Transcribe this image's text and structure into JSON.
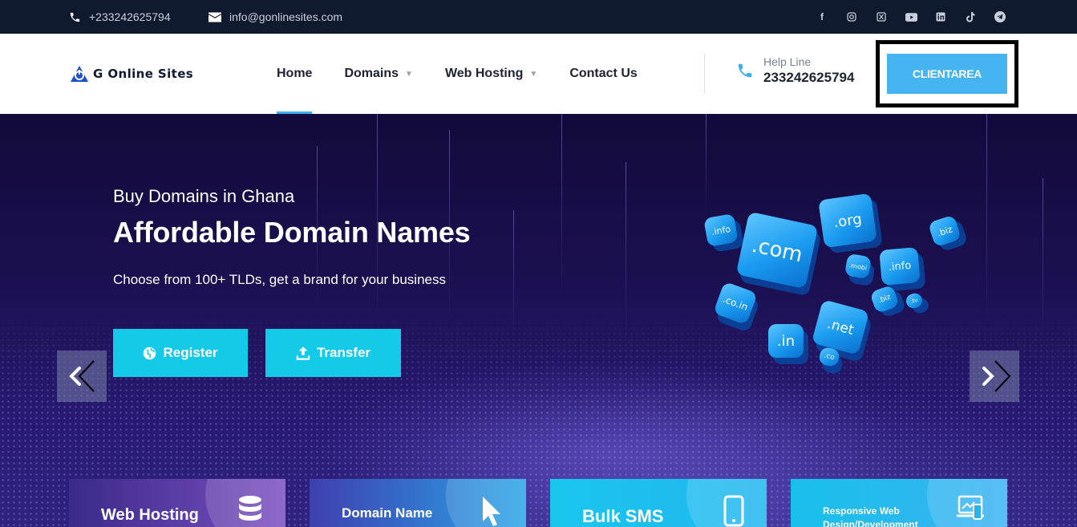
{
  "topbar": {
    "phone": "+233242625794",
    "email": "info@gonlinesites.com",
    "socials": [
      "facebook-icon",
      "instagram-icon",
      "x-icon",
      "youtube-icon",
      "linkedin-icon",
      "tiktok-icon",
      "telegram-icon"
    ]
  },
  "header": {
    "logo_text": "G Online Sites",
    "nav": [
      {
        "label": "Home",
        "active": true
      },
      {
        "label": "Domains",
        "dropdown": true
      },
      {
        "label": "Web Hosting",
        "dropdown": true
      },
      {
        "label": "Contact Us"
      }
    ],
    "helpline_label": "Help Line",
    "helpline_number": "233242625794",
    "client_button": "CLIENTAREA"
  },
  "hero": {
    "subtitle": "Buy Domains in Ghana",
    "title": "Affordable Domain Names",
    "description": "Choose from 100+ TLDs, get a brand for your business",
    "register_label": "Register",
    "transfer_label": "Transfer",
    "tlds": [
      ".com",
      ".org",
      ".info",
      ".biz",
      ".info",
      ".mobi",
      ".co.in",
      ".net",
      ".biz",
      ".tv",
      ".in",
      ".co"
    ]
  },
  "cards": [
    {
      "label": "Web Hosting",
      "icon": "database-icon"
    },
    {
      "label": "Domain Name",
      "icon": "cursor-icon"
    },
    {
      "label": "Bulk SMS",
      "icon": "mobile-icon"
    },
    {
      "label": "Responsive Web Design/Development",
      "icon": "devices-icon"
    }
  ],
  "colors": {
    "topbar_bg": "#101a2e",
    "accent": "#45b4f0",
    "hero_button": "#13cbe8",
    "hero_bg": "#1b1050"
  }
}
